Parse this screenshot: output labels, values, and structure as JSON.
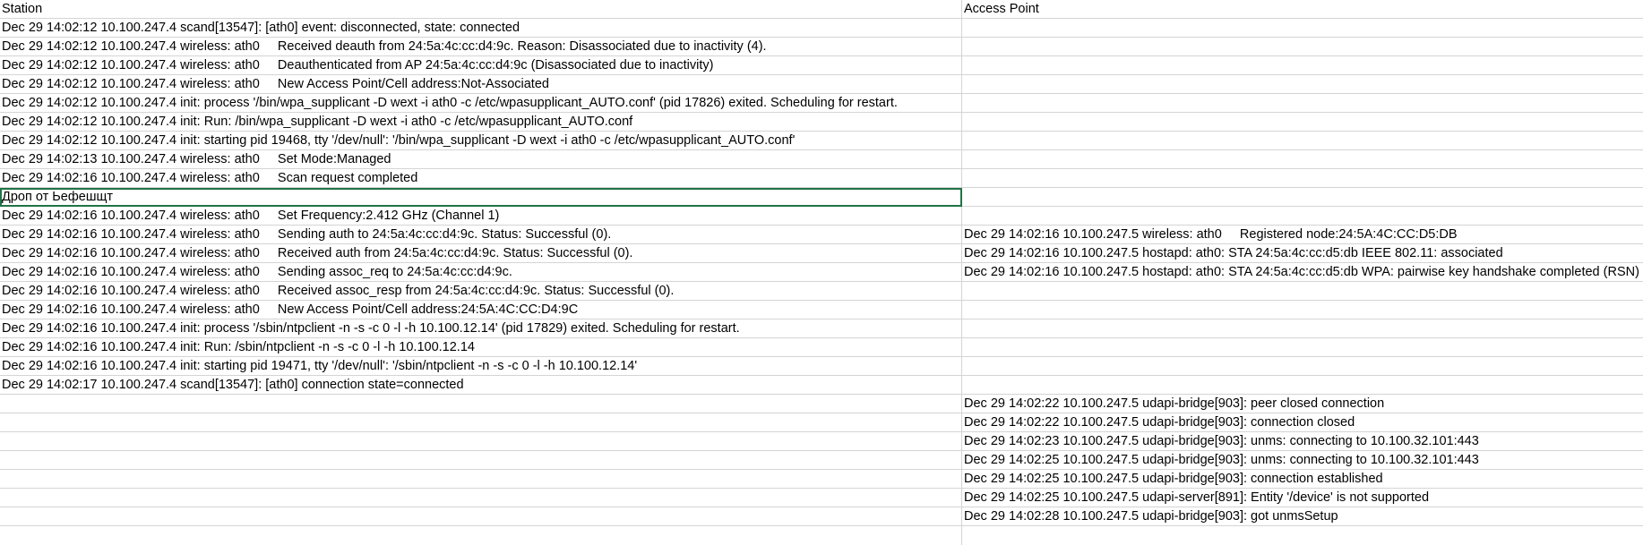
{
  "columns": {
    "a_header": "Station",
    "b_header": "Access Point"
  },
  "rows": [
    {
      "a": "Dec 29 14:02:12 10.100.247.4 scand[13547]: [ath0] event: disconnected, state: connected",
      "b": ""
    },
    {
      "a": "Dec 29 14:02:12 10.100.247.4 wireless: ath0     Received deauth from 24:5a:4c:cc:d4:9c. Reason: Disassociated due to inactivity (4).",
      "b": ""
    },
    {
      "a": "Dec 29 14:02:12 10.100.247.4 wireless: ath0     Deauthenticated from AP 24:5a:4c:cc:d4:9c (Disassociated due to inactivity)",
      "b": ""
    },
    {
      "a": "Dec 29 14:02:12 10.100.247.4 wireless: ath0     New Access Point/Cell address:Not-Associated",
      "b": ""
    },
    {
      "a": "Dec 29 14:02:12 10.100.247.4 init: process '/bin/wpa_supplicant -D wext -i ath0 -c /etc/wpasupplicant_AUTO.conf' (pid 17826) exited. Scheduling for restart.",
      "b": ""
    },
    {
      "a": "Dec 29 14:02:12 10.100.247.4 init: Run: /bin/wpa_supplicant -D wext -i ath0 -c /etc/wpasupplicant_AUTO.conf",
      "b": ""
    },
    {
      "a": "Dec 29 14:02:12 10.100.247.4 init: starting pid 19468, tty '/dev/null': '/bin/wpa_supplicant -D wext -i ath0 -c /etc/wpasupplicant_AUTO.conf'",
      "b": ""
    },
    {
      "a": "Dec 29 14:02:13 10.100.247.4 wireless: ath0     Set Mode:Managed",
      "b": ""
    },
    {
      "a": "Dec 29 14:02:16 10.100.247.4 wireless: ath0     Scan request completed",
      "b": ""
    },
    {
      "a": "Дроп от Ьефешщт",
      "b": ""
    },
    {
      "a": "Dec 29 14:02:16 10.100.247.4 wireless: ath0     Set Frequency:2.412 GHz (Channel 1)",
      "b": ""
    },
    {
      "a": "Dec 29 14:02:16 10.100.247.4 wireless: ath0     Sending auth to 24:5a:4c:cc:d4:9c. Status: Successful (0).",
      "b": "Dec 29 14:02:16 10.100.247.5 wireless: ath0     Registered node:24:5A:4C:CC:D5:DB"
    },
    {
      "a": "Dec 29 14:02:16 10.100.247.4 wireless: ath0     Received auth from 24:5a:4c:cc:d4:9c. Status: Successful (0).",
      "b": "Dec 29 14:02:16 10.100.247.5 hostapd: ath0: STA 24:5a:4c:cc:d5:db IEEE 802.11: associated"
    },
    {
      "a": "Dec 29 14:02:16 10.100.247.4 wireless: ath0     Sending assoc_req to 24:5a:4c:cc:d4:9c.",
      "b": "Dec 29 14:02:16 10.100.247.5 hostapd: ath0: STA 24:5a:4c:cc:d5:db WPA: pairwise key handshake completed (RSN)"
    },
    {
      "a": "Dec 29 14:02:16 10.100.247.4 wireless: ath0     Received assoc_resp from 24:5a:4c:cc:d4:9c. Status: Successful (0).",
      "b": ""
    },
    {
      "a": "Dec 29 14:02:16 10.100.247.4 wireless: ath0     New Access Point/Cell address:24:5A:4C:CC:D4:9C",
      "b": ""
    },
    {
      "a": "Dec 29 14:02:16 10.100.247.4 init: process '/sbin/ntpclient -n -s -c 0 -l -h 10.100.12.14' (pid 17829) exited. Scheduling for restart.",
      "b": ""
    },
    {
      "a": "Dec 29 14:02:16 10.100.247.4 init: Run: /sbin/ntpclient -n -s -c 0 -l -h 10.100.12.14",
      "b": ""
    },
    {
      "a": "Dec 29 14:02:16 10.100.247.4 init: starting pid 19471, tty '/dev/null': '/sbin/ntpclient -n -s -c 0 -l -h 10.100.12.14'",
      "b": ""
    },
    {
      "a": "Dec 29 14:02:17 10.100.247.4 scand[13547]: [ath0] connection state=connected",
      "b": ""
    },
    {
      "a": "",
      "b": "Dec 29 14:02:22 10.100.247.5 udapi-bridge[903]: peer closed connection"
    },
    {
      "a": "",
      "b": "Dec 29 14:02:22 10.100.247.5 udapi-bridge[903]: connection closed"
    },
    {
      "a": "",
      "b": "Dec 29 14:02:23 10.100.247.5 udapi-bridge[903]: unms: connecting to 10.100.32.101:443"
    },
    {
      "a": "",
      "b": "Dec 29 14:02:25 10.100.247.5 udapi-bridge[903]: unms: connecting to 10.100.32.101:443"
    },
    {
      "a": "",
      "b": "Dec 29 14:02:25 10.100.247.5 udapi-bridge[903]: connection established"
    },
    {
      "a": "",
      "b": "Dec 29 14:02:25 10.100.247.5 udapi-server[891]: Entity '/device' is not supported"
    },
    {
      "a": "",
      "b": "Dec 29 14:02:28 10.100.247.5 udapi-bridge[903]: got unmsSetup"
    }
  ],
  "selected_row_index": 9,
  "colors": {
    "selection": "#217346",
    "gridline": "#d4d4d4"
  }
}
